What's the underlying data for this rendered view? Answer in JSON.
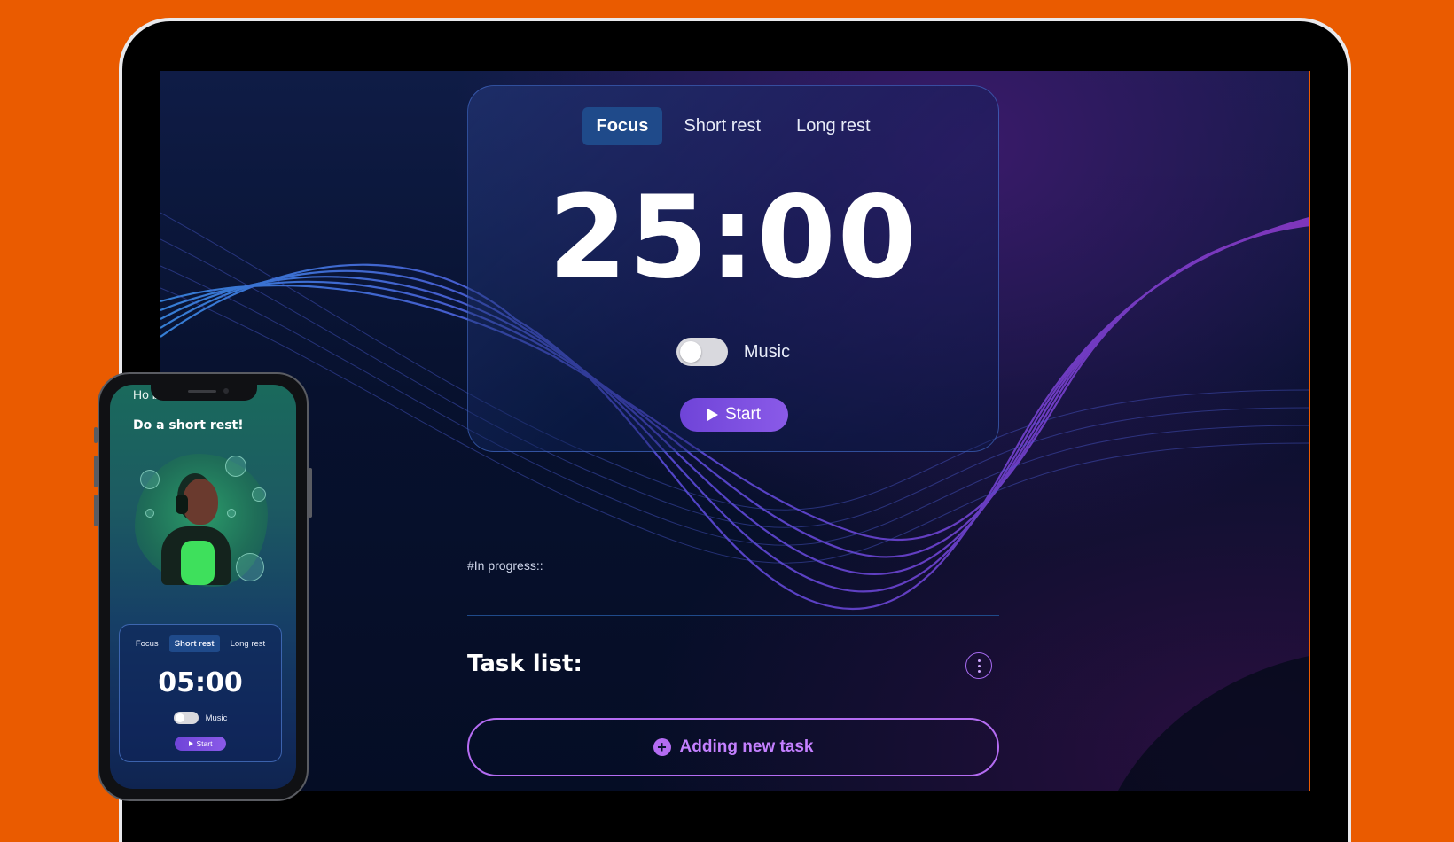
{
  "desktop": {
    "tabs": [
      {
        "label": "Focus",
        "active": true
      },
      {
        "label": "Short rest",
        "active": false
      },
      {
        "label": "Long rest",
        "active": false
      }
    ],
    "timer": "25:00",
    "music_label": "Music",
    "music_on": false,
    "start_label": "Start",
    "progress_label": "#In progress::",
    "task_list_title": "Task list:",
    "add_task_label": "Adding new task"
  },
  "mobile": {
    "greeting_line1": "Ho          breath?,",
    "greeting_line2": "Do a short rest!",
    "tabs": [
      {
        "label": "Focus",
        "active": false
      },
      {
        "label": "Short rest",
        "active": true
      },
      {
        "label": "Long rest",
        "active": false
      }
    ],
    "timer": "05:00",
    "music_label": "Music",
    "music_on": false,
    "start_label": "Start"
  },
  "colors": {
    "background": "#ea5b00",
    "accent_purple": "#b46cf2",
    "tab_active": "#1f4a8a",
    "screen_bg": "#07112e"
  },
  "icons": [
    "play-icon",
    "plus-circle-icon",
    "more-vertical-icon"
  ]
}
